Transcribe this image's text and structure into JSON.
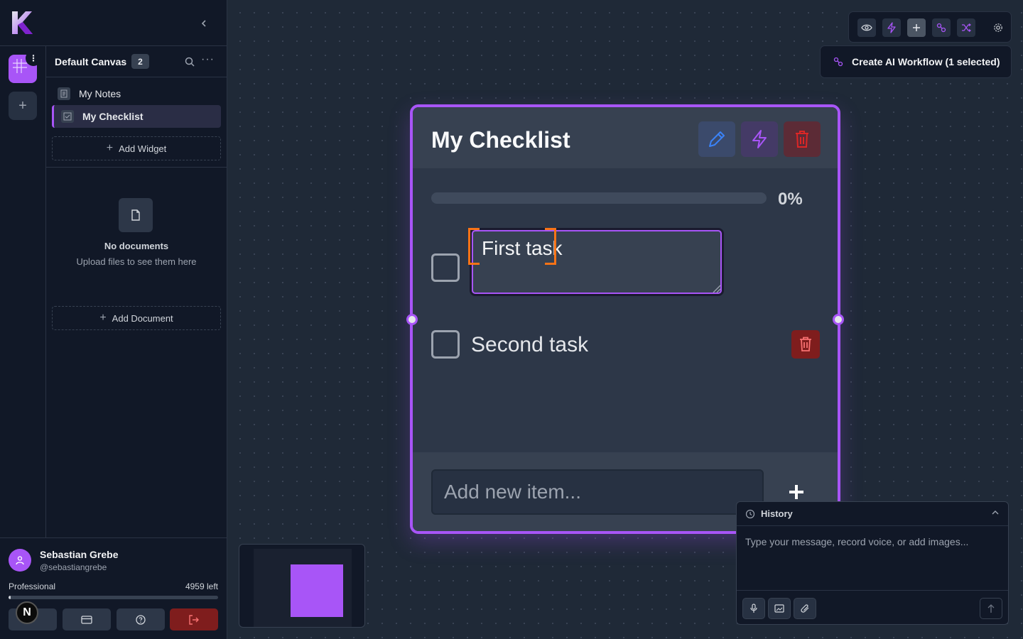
{
  "sidebar": {
    "canvas_name": "Default Canvas",
    "widget_count": "2",
    "widgets": [
      {
        "label": "My Notes",
        "icon": "note-icon"
      },
      {
        "label": "My Checklist",
        "icon": "checklist-icon",
        "active": true
      }
    ],
    "add_widget_label": "Add Widget",
    "no_docs_title": "No documents",
    "no_docs_sub": "Upload files to see them here",
    "add_document_label": "Add Document",
    "user": {
      "name": "Sebastian Grebe",
      "handle": "@sebastiangrebe",
      "plan": "Professional",
      "credits_left": "4959 left",
      "credits_used_fraction": 0.01
    },
    "badge_letter": "N"
  },
  "toolbar": {
    "icons": [
      "eye-icon",
      "bolt-icon",
      "plus-icon",
      "workflow-icon",
      "shuffle-icon",
      "gear-icon"
    ],
    "workflow_label": "Create AI Workflow (1 selected)"
  },
  "checklist": {
    "title": "My Checklist",
    "progress_percent": 0,
    "progress_label": "0%",
    "items": [
      {
        "text": "First task",
        "checked": false,
        "editing": true
      },
      {
        "text": "Second task",
        "checked": false
      }
    ],
    "add_placeholder": "Add new item..."
  },
  "chat": {
    "history_label": "History",
    "placeholder": "Type your message, record voice, or add images..."
  },
  "colors": {
    "accent": "#a855f7",
    "danger": "#7f1d1d",
    "selection": "#f97316"
  }
}
